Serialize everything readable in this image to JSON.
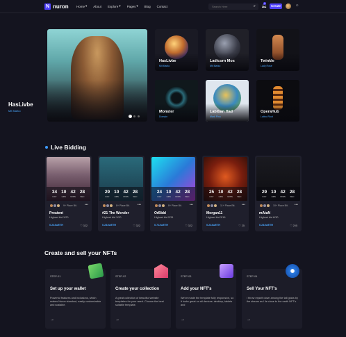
{
  "nav": {
    "logo_letter": "N",
    "logo_text": "nuron",
    "menu": [
      "Home",
      "About",
      "Explore",
      "Pages",
      "Blog",
      "Contact"
    ],
    "search_placeholder": "Search Here",
    "notification_count": "1",
    "create_label": "Create"
  },
  "hero": {
    "title": "HasLivbe",
    "subtitle": "Mit Marko"
  },
  "featured": [
    {
      "title": "HasLivbe",
      "subtitle": "Mit Marko"
    },
    {
      "title": "Ladicorn Mos",
      "subtitle": "Mit Marko"
    },
    {
      "title": "Twinkle",
      "subtitle": "Lady Rose"
    },
    {
      "title": "Monster",
      "subtitle": "Domain"
    },
    {
      "title": "Labiban Had",
      "subtitle": "Mark Pinu"
    },
    {
      "title": "OperaHub",
      "subtitle": "Latino Root"
    }
  ],
  "live_bidding": {
    "title": "Live Bidding",
    "cards": [
      {
        "days": "34",
        "hrs": "10",
        "mins": "42",
        "secs": "28",
        "owner": "9+ Place Bit.",
        "name": "Preatent",
        "bid": "Highest bid 1/20",
        "price": "0.244wETH",
        "likes": "322"
      },
      {
        "days": "29",
        "hrs": "10",
        "mins": "42",
        "secs": "28",
        "owner": "8+ Place Bit.",
        "name": "#21 The Wonder",
        "bid": "Highest bid 1/20",
        "price": "0.244wETH",
        "likes": "322"
      },
      {
        "days": "24",
        "hrs": "10",
        "mins": "42",
        "secs": "28",
        "owner": "8+ Place Bit.",
        "name": "OrBidd",
        "bid": "Highest bid 2/31",
        "price": "0.712wETH",
        "likes": "322"
      },
      {
        "days": "25",
        "hrs": "10",
        "mins": "42",
        "secs": "28",
        "owner": "11+ Place Bit.",
        "name": "Morgan11",
        "bid": "Highest bid 3/16",
        "price": "0.244wETH",
        "likes": "25"
      },
      {
        "days": "29",
        "hrs": "10",
        "mins": "42",
        "secs": "28",
        "owner": "10+ Place Bit.",
        "name": "mAtaN",
        "bid": "Highest bid 6/30",
        "price": "0.244wETH",
        "likes": "205"
      }
    ],
    "labels": {
      "day": "DAY",
      "hrs": "HRS",
      "mins": "MINS",
      "sec": "SEC"
    }
  },
  "create_sell": {
    "title": "Create and sell your NFTs",
    "steps": [
      {
        "num": "STEP-01",
        "title": "Set up your wallet",
        "desc": "Powerful features and inclusions, which makes Nuron standout, easily customizable and scalable."
      },
      {
        "num": "STEP-02",
        "title": "Create your collection",
        "desc": "A great collection of beautiful website templates for your need. Choose the best suitable template."
      },
      {
        "num": "STEP-03",
        "title": "Add your NFT's",
        "desc": "We've made the template fully responsive, so it looks great on all devices: desktop, tablets and"
      },
      {
        "num": "STEP-04",
        "title": "Sell Your NFT's",
        "desc": "I throw myself down among the tall grass by the stream as I lie close to the earth NFT's."
      }
    ]
  },
  "colors": {
    "accent": "#5142fc",
    "link": "#4aa8ff",
    "bg": "#14141f"
  }
}
